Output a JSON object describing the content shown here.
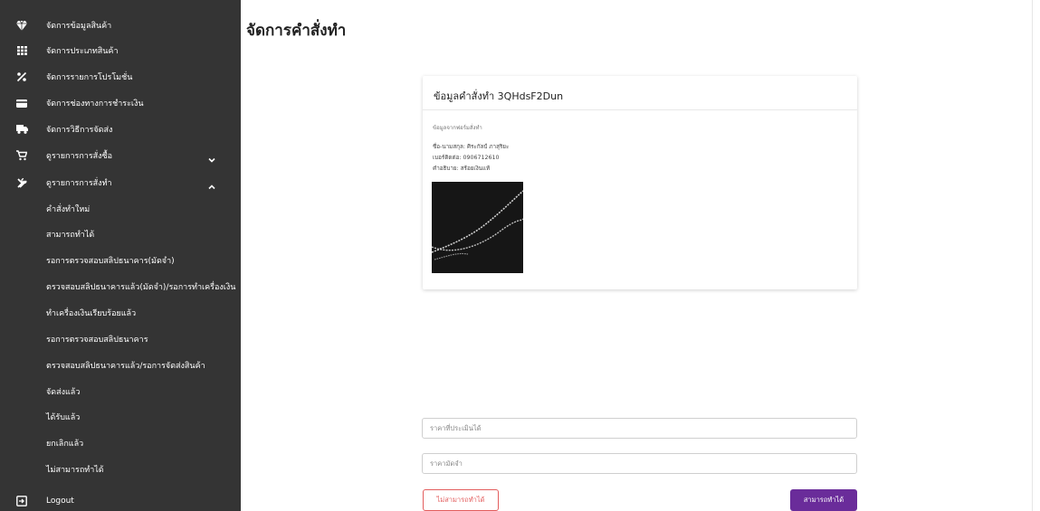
{
  "colors": {
    "sidebar_bg": "#343434",
    "accent": "#6a2c9a",
    "danger": "#e35d5d"
  },
  "sidebar": {
    "items": [
      {
        "label": "จัดการข้อมูลสินค้า",
        "icon": "diamond-icon"
      },
      {
        "label": "จัดการประเภทสินค้า",
        "icon": "grid-icon"
      },
      {
        "label": "จัดการรายการโปรโมชั่น",
        "icon": "percent-icon"
      },
      {
        "label": "จัดการช่องทางการชำระเงิน",
        "icon": "credit-card-icon"
      },
      {
        "label": "จัดการวิธีการจัดส่ง",
        "icon": "truck-icon"
      },
      {
        "label": "ดูรายการการสั่งซื้อ",
        "icon": "cart-icon"
      },
      {
        "label": "ดูรายการการสั่งทำ",
        "icon": "tools-icon"
      }
    ],
    "sub_items": [
      "คำสั่งทำใหม่",
      "สามารถทำได้",
      "รอการตรวจสอบสลิปธนาคาร(มัดจำ)",
      "ตรวจสอบสลิปธนาคารแล้ว(มัดจำ)/รอการทำเครื่องเงิน",
      "ทำเครื่องเงินเรียบร้อยแล้ว",
      "รอการตรวจสอบสลิปธนาคาร",
      "ตรวจสอบสลิปธนาคารแล้ว/รอการจัดส่งสินค้า",
      "จัดส่งแล้ว",
      "ได้รับแล้ว",
      "ยกเลิกแล้ว",
      "ไม่สามารถทำได้"
    ],
    "logout": "Logout"
  },
  "page": {
    "title": "จัดการคำสั่งทำ"
  },
  "card": {
    "title": "ข้อมูลคำสั่งทำ 3QHdsF2Dun",
    "section_label": "ข้อมูลจากฟอร์มสั่งทำ",
    "name_line": "ชื่อ-นามสกุล: ศิระกัลป์ ภาสุริยะ",
    "phone_line": "เบอร์ติดต่อ: 0906712610",
    "desc_line": "คำอธิบาย: สร้อยเงินแท้"
  },
  "form": {
    "price_placeholder": "ราคาที่ประเมินได้",
    "deposit_placeholder": "ราคามัดจำ",
    "reject_label": "ไม่สามารถทำได้",
    "accept_label": "สามารถทำได้"
  }
}
